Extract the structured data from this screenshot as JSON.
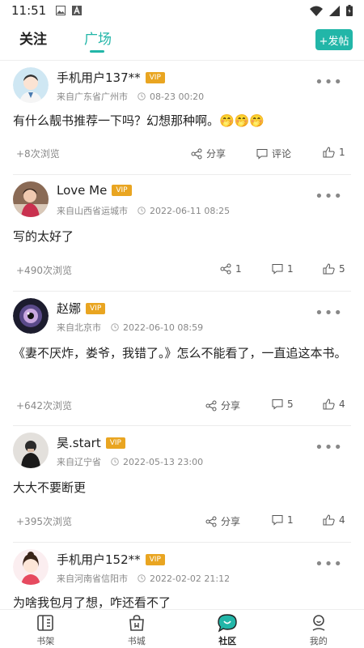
{
  "status_bar": {
    "time": "11:51"
  },
  "tabs": {
    "follow": "关注",
    "square": "广场"
  },
  "post_button": "+发帖",
  "posts": [
    {
      "username": "手机用户137**",
      "vip": "VIP",
      "location": "来自广东省广州市",
      "time": "08-23 00:20",
      "content": "有什么靓书推荐一下吗？幻想那种啊。🤭🤭🤭",
      "views": "+8次浏览",
      "share": "分享",
      "comment": "评论",
      "likes": "1"
    },
    {
      "username": "Love Me",
      "vip": "VIP",
      "location": "来自山西省运城市",
      "time": "2022-06-11 08:25",
      "content": "写的太好了",
      "views": "+490次浏览",
      "share": "1",
      "comment": "1",
      "likes": "5"
    },
    {
      "username": "赵娜",
      "vip": "VIP",
      "location": "来自北京市",
      "time": "2022-06-10 08:59",
      "content": "《妻不厌炸，娄爷，我错了。》怎么不能看了，一直追这本书。",
      "views": "+642次浏览",
      "share": "分享",
      "comment": "5",
      "likes": "4"
    },
    {
      "username": "昊.start",
      "vip": "VIP",
      "location": "来自辽宁省",
      "time": "2022-05-13 23:00",
      "content": "大大不要断更",
      "views": "+395次浏览",
      "share": "分享",
      "comment": "1",
      "likes": "4"
    },
    {
      "username": "手机用户152**",
      "vip": "VIP",
      "location": "来自河南省信阳市",
      "time": "2022-02-02 21:12",
      "content": "为啥我包月了想，咋还看不了"
    }
  ],
  "bottom_nav": [
    "书架",
    "书城",
    "社区",
    "我的"
  ],
  "colors": {
    "accent": "#22b6a8",
    "vip": "#e9a521"
  }
}
